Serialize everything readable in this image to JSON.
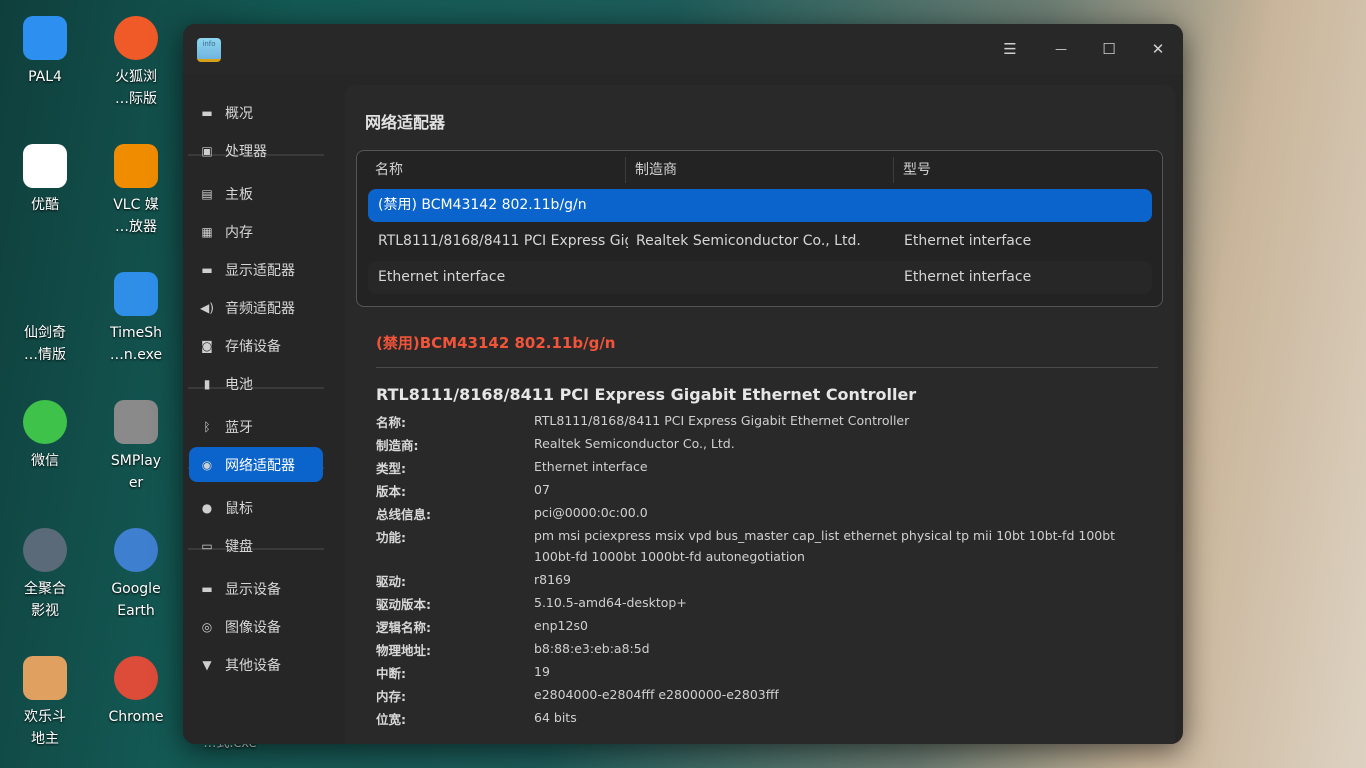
{
  "desktop": {
    "icons": [
      {
        "label": "PAL4",
        "color": "#2d8ff0"
      },
      {
        "label": "火狐浏\n…际版",
        "color": "#f05a28"
      },
      {
        "label": "优酷",
        "color": "#ffffff"
      },
      {
        "label": "VLC 媒\n…放器",
        "color": "#f08c00"
      },
      {
        "label": "仙剑奇\n…情版",
        "color": "transparent"
      },
      {
        "label": "TimeSh\n…n.exe",
        "color": "#2f8fe8"
      },
      {
        "label": "微信",
        "color": "#3fc24a"
      },
      {
        "label": "SMPlay\ner",
        "color": "#8a8a8a"
      },
      {
        "label": "全聚合\n影视",
        "color": "#5a6a78"
      },
      {
        "label": "Google\nEarth",
        "color": "#3f7fd0"
      },
      {
        "label": "欢乐斗\n地主",
        "color": "#e0a060"
      },
      {
        "label": "Chrome",
        "color": "#dd4b39"
      }
    ],
    "hidden_label": "…式.exe"
  },
  "window": {
    "app_icon_text": "info",
    "buttons": {
      "menu": "☰",
      "minimize": "—",
      "maximize": "☐",
      "close": "✕"
    }
  },
  "sidebar": {
    "items": [
      {
        "label": "概况",
        "icon": "computer-icon",
        "glyph": "▬"
      },
      {
        "label": "处理器",
        "icon": "cpu-icon",
        "glyph": "▣"
      },
      {
        "label": "主板",
        "icon": "motherboard-icon",
        "glyph": "▤"
      },
      {
        "label": "内存",
        "icon": "memory-icon",
        "glyph": "▦"
      },
      {
        "label": "显示适配器",
        "icon": "display-adapter-icon",
        "glyph": "▬"
      },
      {
        "label": "音频适配器",
        "icon": "speaker-icon",
        "glyph": "◀)"
      },
      {
        "label": "存储设备",
        "icon": "storage-icon",
        "glyph": "◙"
      },
      {
        "label": "电池",
        "icon": "battery-icon",
        "glyph": "▮"
      },
      {
        "label": "蓝牙",
        "icon": "bluetooth-icon",
        "glyph": "ᛒ"
      },
      {
        "label": "网络适配器",
        "icon": "network-icon",
        "glyph": "◉"
      },
      {
        "label": "鼠标",
        "icon": "mouse-icon",
        "glyph": "●"
      },
      {
        "label": "键盘",
        "icon": "keyboard-icon",
        "glyph": "▭"
      },
      {
        "label": "显示设备",
        "icon": "monitor-icon",
        "glyph": "▬"
      },
      {
        "label": "图像设备",
        "icon": "camera-icon",
        "glyph": "◎"
      },
      {
        "label": "其他设备",
        "icon": "other-device-icon",
        "glyph": "▼"
      }
    ],
    "selected": "网络适配器"
  },
  "main": {
    "title": "网络适配器",
    "table": {
      "headers": [
        "名称",
        "制造商",
        "型号"
      ],
      "rows": [
        [
          "(禁用) BCM43142 802.11b/g/n",
          "",
          ""
        ],
        [
          "RTL8111/8168/8411 PCI Express Gig…",
          "Realtek Semiconductor Co., Ltd.",
          "Ethernet interface"
        ],
        [
          "Ethernet interface",
          "",
          "Ethernet interface"
        ]
      ]
    },
    "disabled_heading": "(禁用)BCM43142 802.11b/g/n",
    "detail": {
      "title": "RTL8111/8168/8411 PCI Express Gigabit Ethernet Controller",
      "fields": [
        {
          "label": "名称:",
          "value": "RTL8111/8168/8411 PCI Express Gigabit Ethernet Controller"
        },
        {
          "label": "制造商:",
          "value": "Realtek Semiconductor Co., Ltd."
        },
        {
          "label": "类型:",
          "value": "Ethernet interface"
        },
        {
          "label": "版本:",
          "value": "07"
        },
        {
          "label": "总线信息:",
          "value": "pci@0000:0c:00.0"
        },
        {
          "label": "功能:",
          "value": "pm msi pciexpress msix vpd bus_master cap_list ethernet physical tp mii 10bt 10bt-fd 100bt 100bt-fd 1000bt 1000bt-fd autonegotiation"
        },
        {
          "label": "驱动:",
          "value": "r8169"
        },
        {
          "label": "驱动版本:",
          "value": "5.10.5-amd64-desktop+"
        },
        {
          "label": "逻辑名称:",
          "value": "enp12s0"
        },
        {
          "label": "物理地址:",
          "value": "b8:88:e3:eb:a8:5d"
        },
        {
          "label": "中断:",
          "value": "19"
        },
        {
          "label": "内存:",
          "value": "e2804000-e2804fff e2800000-e2803fff"
        },
        {
          "label": "位宽:",
          "value": "64 bits"
        }
      ]
    }
  },
  "colors": {
    "accent": "#0a64cc",
    "disabled": "#f2543a"
  }
}
